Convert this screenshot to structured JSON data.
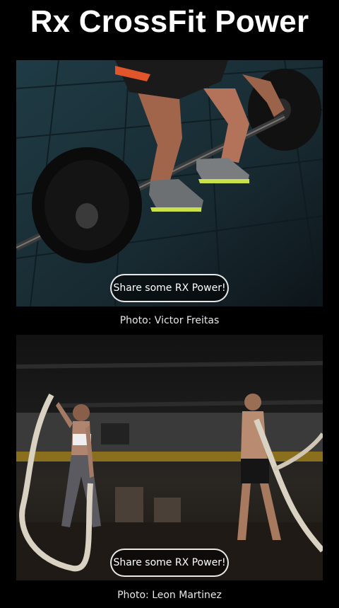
{
  "page": {
    "title": "Rx CrossFit Power"
  },
  "cards": [
    {
      "image": "Person gripping a loaded barbell on a dark rubber gym floor",
      "button_label": "Share some RX Power!",
      "credit": "Photo: Victor Freitas"
    },
    {
      "image": "Two athletes swinging battle ropes inside a dim gym",
      "button_label": "Share some RX Power!",
      "credit": "Photo: Leon Martinez"
    }
  ],
  "colors": {
    "background": "#000000",
    "text": "#ffffff",
    "shoe_accent": "#c8e04a",
    "shorts_accent": "#e0552a"
  }
}
